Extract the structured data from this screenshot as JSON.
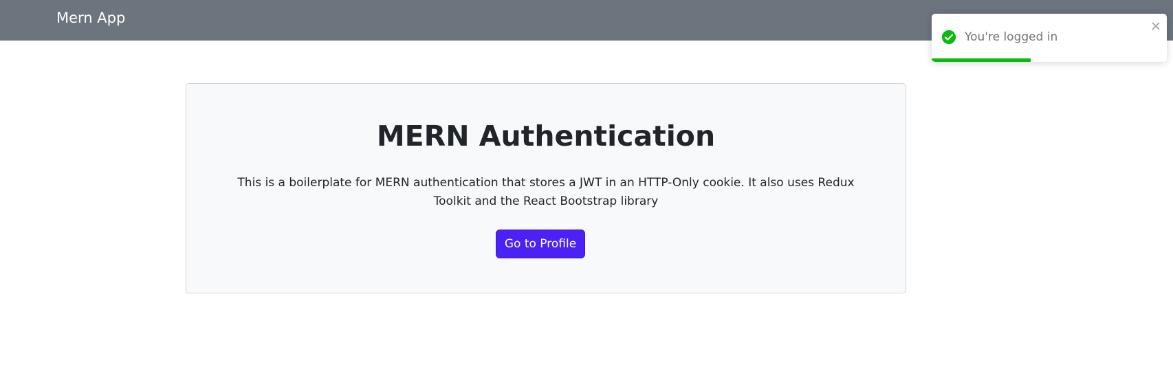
{
  "navbar": {
    "brand": "Mern App"
  },
  "hero": {
    "title": "MERN Authentication",
    "description": "This is a boilerplate for MERN authentication that stores a JWT in an HTTP-Only cookie. It also uses Redux Toolkit and the React Bootstrap library",
    "button_label": "Go to Profile"
  },
  "toast": {
    "message": "You're logged in",
    "type": "success",
    "progress": 0.42,
    "icon": "check-circle-icon",
    "close_icon": "close-icon"
  },
  "colors": {
    "navbar": "#6c757d",
    "primary_button": "#4b21f6",
    "success": "#07bc0c",
    "card_bg": "#f8f9fa"
  }
}
